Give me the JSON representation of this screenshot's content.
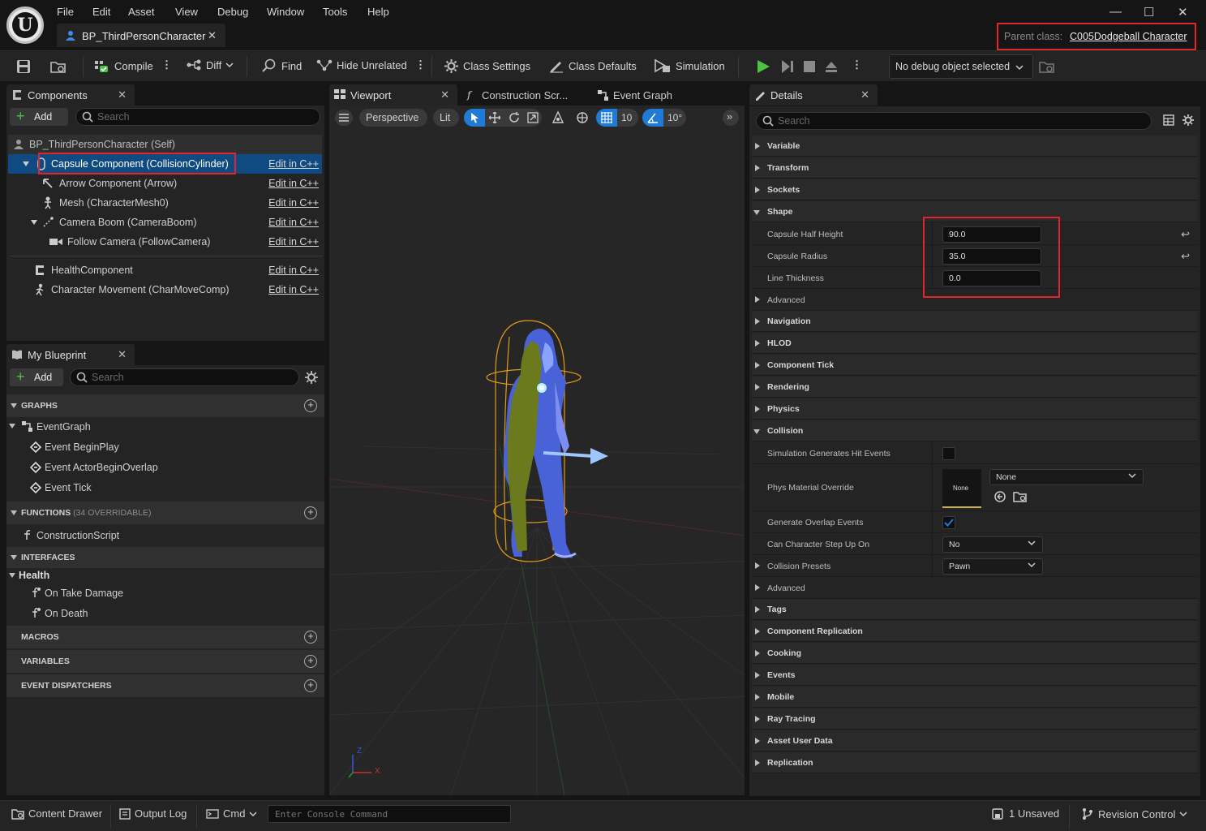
{
  "menu": [
    "File",
    "Edit",
    "Asset",
    "View",
    "Debug",
    "Window",
    "Tools",
    "Help"
  ],
  "document_tab": "BP_ThirdPersonCharacter",
  "parent_class": {
    "label": "Parent class:",
    "value": "C005Dodgeball Character"
  },
  "toolbar": {
    "compile": "Compile",
    "diff": "Diff",
    "find": "Find",
    "hide_unrelated": "Hide Unrelated",
    "class_settings": "Class Settings",
    "class_defaults": "Class Defaults",
    "simulation": "Simulation",
    "debug_object": "No debug object selected"
  },
  "components_panel": {
    "tab": "Components",
    "add": "Add",
    "search_placeholder": "Search",
    "root": "BP_ThirdPersonCharacter (Self)",
    "edit_label": "Edit in C++",
    "items": [
      {
        "label": "Capsule Component (CollisionCylinder)",
        "selected": true,
        "icon": "capsule-icon"
      },
      {
        "label": "Arrow Component (Arrow)",
        "icon": "arrow-icon"
      },
      {
        "label": "Mesh (CharacterMesh0)",
        "icon": "skeleton-icon"
      },
      {
        "label": "Camera Boom (CameraBoom)",
        "icon": "spring-arm-icon"
      },
      {
        "label": "Follow Camera (FollowCamera)",
        "icon": "camera-icon"
      },
      {
        "label": "HealthComponent",
        "icon": "component-icon"
      },
      {
        "label": "Character Movement (CharMoveComp)",
        "icon": "movement-icon"
      }
    ]
  },
  "my_blueprint": {
    "tab": "My Blueprint",
    "add": "Add",
    "search_placeholder": "Search",
    "graphs_header": "GRAPHS",
    "event_graph": "EventGraph",
    "events": [
      "Event BeginPlay",
      "Event ActorBeginOverlap",
      "Event Tick"
    ],
    "functions_header": "FUNCTIONS",
    "functions_overridable": "(34 OVERRIDABLE)",
    "construction_script": "ConstructionScript",
    "interfaces_header": "INTERFACES",
    "interface_name": "Health",
    "interface_functions": [
      "On Take Damage",
      "On Death"
    ],
    "macros_header": "MACROS",
    "variables_header": "VARIABLES",
    "dispatchers_header": "EVENT DISPATCHERS"
  },
  "viewport": {
    "tabs": [
      "Viewport",
      "Construction Scr...",
      "Event Graph"
    ],
    "perspective": "Perspective",
    "lit": "Lit",
    "grid_size": "10",
    "rotation_snap": "10°",
    "axis_x": "X",
    "axis_z": "Z"
  },
  "details": {
    "tab": "Details",
    "search_placeholder": "Search",
    "categories_top": [
      "Variable",
      "Transform",
      "Sockets"
    ],
    "shape": {
      "header": "Shape",
      "props": [
        {
          "label": "Capsule Half Height",
          "value": "90.0"
        },
        {
          "label": "Capsule Radius",
          "value": "35.0"
        },
        {
          "label": "Line Thickness",
          "value": "0.0"
        }
      ],
      "advanced": "Advanced"
    },
    "categories_mid": [
      "Navigation",
      "HLOD",
      "Component Tick",
      "Rendering",
      "Physics"
    ],
    "collision": {
      "header": "Collision",
      "sim_hit_events": "Simulation Generates Hit Events",
      "phys_material": "Phys Material Override",
      "phys_material_thumb": "None",
      "phys_material_value": "None",
      "overlap_events": "Generate Overlap Events",
      "step_up": "Can Character Step Up On",
      "step_up_value": "No",
      "presets": "Collision Presets",
      "presets_value": "Pawn",
      "advanced": "Advanced"
    },
    "categories_bottom": [
      "Tags",
      "Component Replication",
      "Cooking",
      "Events",
      "Mobile",
      "Ray Tracing",
      "Asset User Data",
      "Replication"
    ]
  },
  "statusbar": {
    "content_drawer": "Content Drawer",
    "output_log": "Output Log",
    "cmd": "Cmd",
    "console_placeholder": "Enter Console Command",
    "unsaved": "1 Unsaved",
    "revision_control": "Revision Control"
  },
  "colors": {
    "accent_blue": "#1f7bd6",
    "play_green": "#4fc246",
    "highlight_red": "#e0262c",
    "selection": "#0f4a80"
  }
}
